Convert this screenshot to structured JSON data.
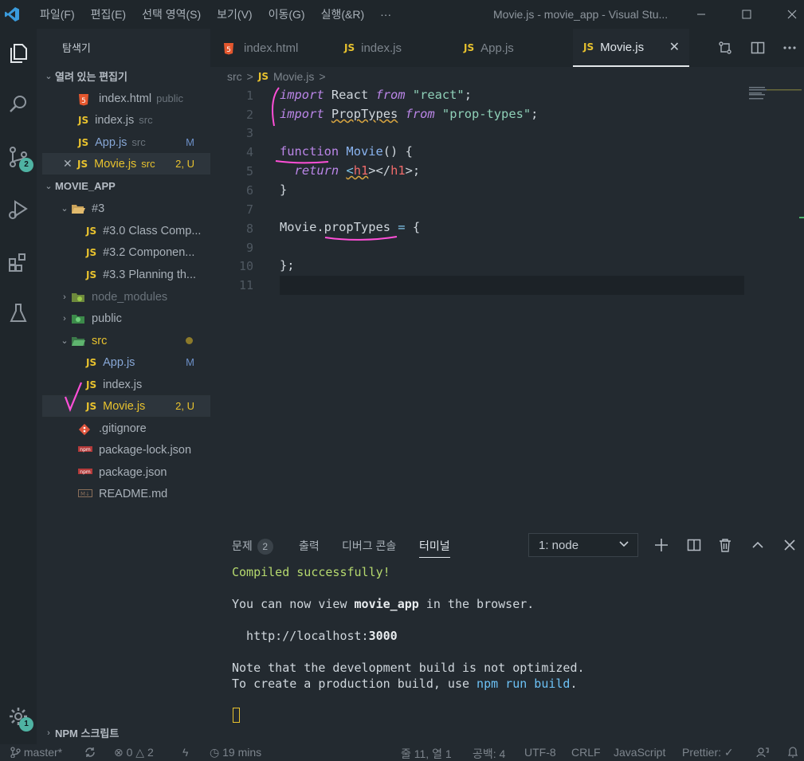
{
  "window": {
    "title": "Movie.js - movie_app - Visual Stu...",
    "menus": [
      "파일(F)",
      "편집(E)",
      "선택 영역(S)",
      "보기(V)",
      "이동(G)",
      "실행(&R)",
      "···"
    ]
  },
  "activity_bar": {
    "source_control_badge": "2",
    "settings_badge": "1"
  },
  "sidebar": {
    "title": "탐색기",
    "open_editors_header": "열려 있는 편집기",
    "open_editors": [
      {
        "name": "index.html",
        "desc": "public"
      },
      {
        "name": "index.js",
        "desc": "src"
      },
      {
        "name": "App.js",
        "desc": "src",
        "badge": "M"
      },
      {
        "name": "Movie.js",
        "desc": "src",
        "badge": "2, U"
      }
    ],
    "project_header": "MOVIE_APP",
    "tree": {
      "folder3": "#3",
      "files3": [
        "#3.0 Class Comp...",
        "#3.2 Componen...",
        "#3.3 Planning th..."
      ],
      "node_modules": "node_modules",
      "public": "public",
      "src": "src",
      "src_files": [
        {
          "name": "App.js",
          "badge": "M"
        },
        {
          "name": "index.js"
        },
        {
          "name": "Movie.js",
          "badge": "2, U"
        }
      ],
      "root_files": [
        ".gitignore",
        "package-lock.json",
        "package.json",
        "README.md"
      ]
    },
    "npm_scripts": "NPM 스크립트"
  },
  "tabs": [
    {
      "label": "index.html",
      "icon": "html-icon"
    },
    {
      "label": "index.js",
      "icon": "JS"
    },
    {
      "label": "App.js",
      "icon": "JS"
    },
    {
      "label": "Movie.js",
      "icon": "JS",
      "active": true
    }
  ],
  "breadcrumb": {
    "folder": "src",
    "sep": ">",
    "file": "Movie.js",
    "tail": ">"
  },
  "editor": {
    "line_numbers": [
      "1",
      "2",
      "3",
      "4",
      "5",
      "6",
      "7",
      "8",
      "9",
      "10",
      "11"
    ],
    "code": {
      "l1_kw": "import",
      "l1_id": " React ",
      "l1_from": "from",
      "l1_str": " \"react\"",
      "l1_end": ";",
      "l2_kw": "import",
      "l2_sp": " ",
      "l2_id": "PropTypes",
      "l2_sp2": " ",
      "l2_from": "from",
      "l2_str": " \"prop-types\"",
      "l2_end": ";",
      "l4_kw": "function",
      "l4_sp": " ",
      "l4_fn": "Movie",
      "l4_rest": "() {",
      "l5_ind": "  ",
      "l5_kw": "return",
      "l5_sp": " ",
      "l5_lt": "<",
      "l5_tag": "h1",
      "l5_mid": "></",
      "l5_tag2": "h1",
      "l5_end": ">;",
      "l6": "}",
      "l8_obj": "Movie",
      "l8_dot": ".",
      "l8_prop": "propTypes",
      "l8_eq": " = ",
      "l8_brace": "{",
      "l10": "};"
    }
  },
  "panel": {
    "tabs": [
      "문제",
      "출력",
      "디버그 콘솔",
      "터미널"
    ],
    "problem_count": "2",
    "terminal_select": "1: node",
    "terminal": {
      "line1": "Compiled successfully!",
      "line2_pre": "You can now view ",
      "line2_app": "movie_app",
      "line2_post": " in the browser.",
      "line3_pre": "  http://localhost:",
      "line3_port": "3000",
      "line4": "Note that the development build is not optimized.",
      "line5_pre": "To create a production build, use ",
      "line5_cmd": "npm run build",
      "line5_post": "."
    }
  },
  "statusbar": {
    "branch": "master*",
    "errors": "0",
    "warnings": "2",
    "time": "19 mins",
    "position": "줄 11, 열 1",
    "spaces": "공백: 4",
    "encoding": "UTF-8",
    "eol": "CRLF",
    "language": "JavaScript",
    "prettier": "Prettier: ✓"
  },
  "colors": {
    "accent_js": "#e8c22e",
    "annotation": "#ff4fd8",
    "terminal_green": "#b6d96e"
  }
}
